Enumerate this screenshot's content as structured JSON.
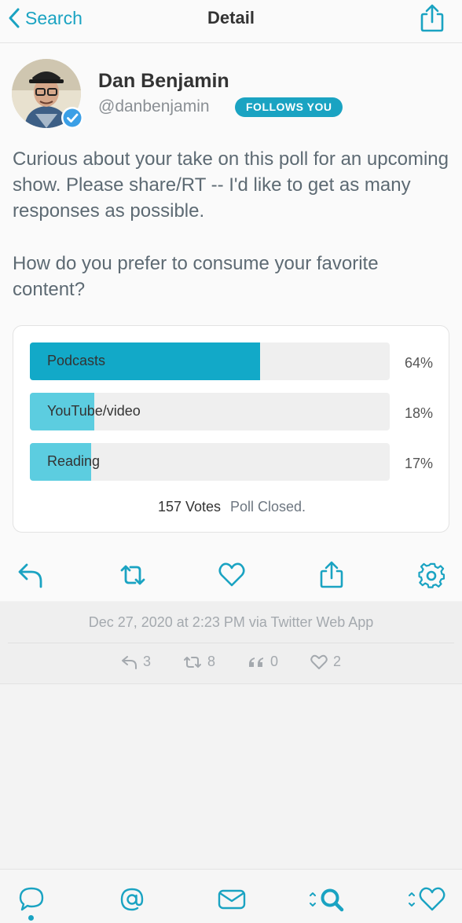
{
  "nav": {
    "back_label": "Search",
    "title": "Detail"
  },
  "tweet": {
    "author_name": "Dan Benjamin",
    "handle": "@danbenjamin",
    "follows_badge": "FOLLOWS YOU",
    "text_para1": "Curious about your take on this poll for an upcoming show. Please share/RT -- I'd like to get as many responses as possible.",
    "text_para2": "How do you prefer to consume your favorite content?"
  },
  "poll": {
    "options": [
      {
        "label": "Podcasts",
        "percent": "64%",
        "fraction": 0.64,
        "fill_color": "#12a9c8"
      },
      {
        "label": "YouTube/video",
        "percent": "18%",
        "fraction": 0.18,
        "fill_color": "#5ccde0"
      },
      {
        "label": "Reading",
        "percent": "17%",
        "fraction": 0.17,
        "fill_color": "#5ccde0"
      }
    ],
    "votes": "157 Votes",
    "status": "Poll Closed."
  },
  "actions": [
    "reply-icon",
    "retweet-icon",
    "like-icon",
    "share-icon",
    "settings-icon"
  ],
  "meta": {
    "timestamp": "Dec 27, 2020 at 2:23 PM via Twitter Web App",
    "replies": "3",
    "retweets": "8",
    "quotes": "0",
    "likes": "2"
  },
  "tabbar": [
    "timeline-tab",
    "mentions-tab",
    "messages-tab",
    "search-tab",
    "likes-tab"
  ],
  "colors": {
    "accent": "#1aa3c2",
    "text": "#5d6a73",
    "muted": "#a4a9ae"
  }
}
